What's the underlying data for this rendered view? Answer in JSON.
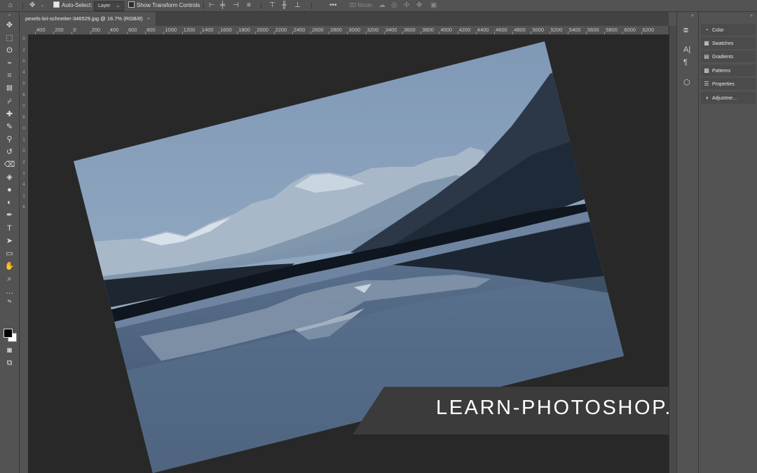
{
  "options_bar": {
    "auto_select_label": "Auto-Select:",
    "layer_select_value": "Layer",
    "show_transform_label": "Show Transform Controls",
    "mode_3d_label": "3D Mode:"
  },
  "document_tab": {
    "title": "pexels-bri-schneiter-346529.jpg @ 16.7% (RGB/8)",
    "close_glyph": "×"
  },
  "ruler": {
    "h_labels": [
      "400",
      "200",
      "0",
      "200",
      "400",
      "600",
      "800",
      "1000",
      "1200",
      "1400",
      "1600",
      "1800",
      "2000",
      "2200",
      "2400",
      "2600",
      "2800",
      "3000",
      "3200",
      "3400",
      "3600",
      "3800",
      "4000",
      "4200",
      "4400",
      "4600",
      "4800",
      "5000",
      "5200",
      "5400",
      "5600",
      "5800",
      "6000",
      "6200"
    ],
    "v_labels": [
      "0",
      "2",
      "0",
      "4",
      "0",
      "6",
      "0",
      "8",
      "0",
      "1",
      "0",
      "2",
      "1",
      "4",
      "1",
      "6"
    ]
  },
  "toolbar": {
    "tools": [
      "move-tool",
      "artboard-tool",
      "lasso-tool",
      "quick-select-tool",
      "crop-tool",
      "frame-tool",
      "eyedropper-tool",
      "healing-tool",
      "brush-tool",
      "clone-stamp-tool",
      "history-brush-tool",
      "eraser-tool",
      "paint-bucket-tool",
      "blur-tool",
      "dodge-tool",
      "pen-tool",
      "type-tool",
      "path-select-tool",
      "rectangle-tool",
      "hand-tool",
      "zoom-tool",
      "more-tools"
    ],
    "foreground_color": "#000000",
    "background_color": "#ffffff"
  },
  "panels": {
    "items": [
      {
        "label": "Color",
        "icon": "color-wheel-icon"
      },
      {
        "label": "Swatches",
        "icon": "swatches-grid-icon"
      },
      {
        "label": "Gradients",
        "icon": "gradient-icon"
      },
      {
        "label": "Patterns",
        "icon": "patterns-grid-icon"
      },
      {
        "label": "Properties",
        "icon": "properties-icon"
      },
      {
        "label": "Adjustme...",
        "icon": "adjustments-icon"
      }
    ]
  },
  "banner": {
    "text": "LEARN-PHOTOSHOP.CLUB"
  },
  "colors": {
    "ui_bg": "#535353",
    "canvas_bg": "#282828",
    "banner_bg": "#3b3b3b"
  }
}
